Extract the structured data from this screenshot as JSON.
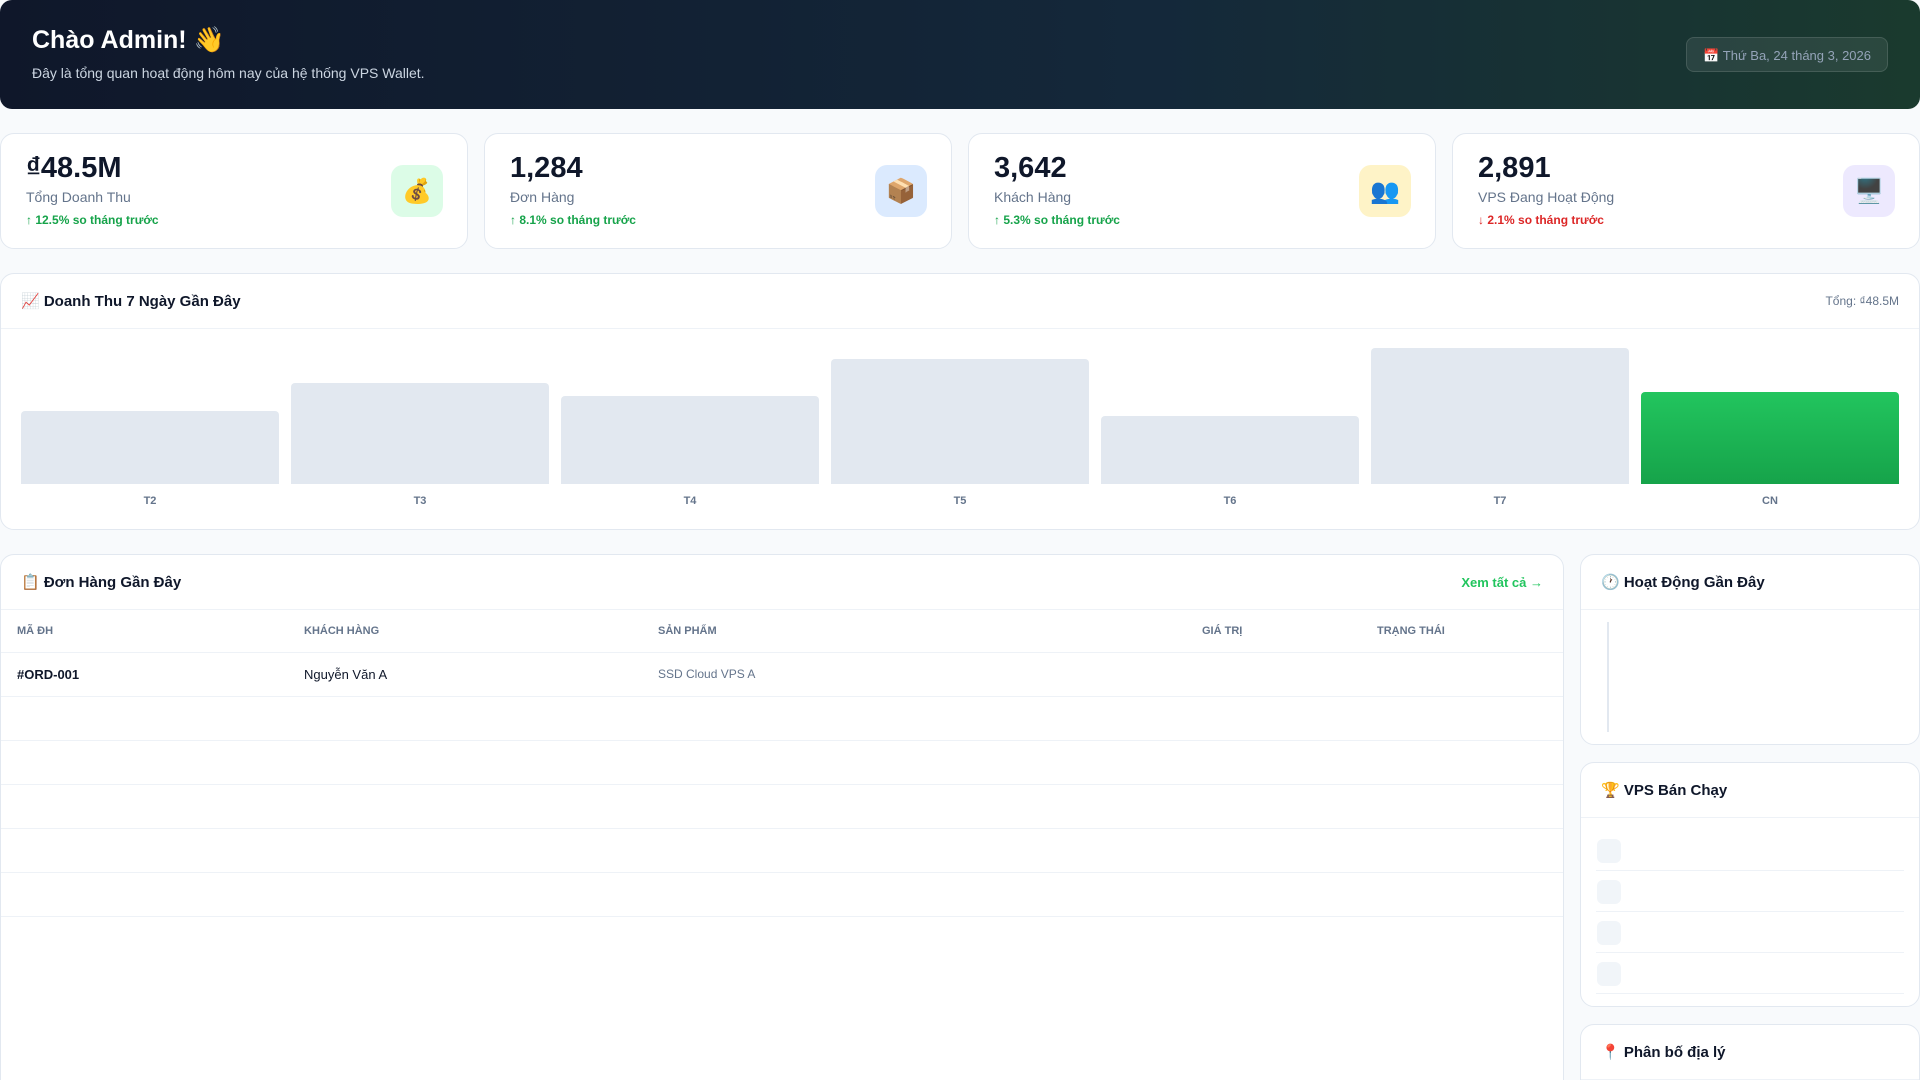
{
  "header": {
    "title": "Chào Admin! 👋",
    "subtitle": "Đây là tổng quan hoạt động hôm nay của hệ thống VPS Wallet.",
    "date": "📅 Thứ Ba, 24 tháng 3, 2026"
  },
  "stats": [
    {
      "value": "₫48.5M",
      "label": "Tổng Doanh Thu",
      "change": "↑ 12.5% so tháng trước",
      "icon": "💰",
      "icon_bg": "#dcfce7"
    },
    {
      "value": "1,284",
      "label": "Đơn Hàng",
      "change": "↑ 8.1% so tháng trước",
      "icon": "📦",
      "icon_bg": "#dbeafe"
    },
    {
      "value": "3,642",
      "label": "Khách Hàng",
      "change": "↑ 5.3% so tháng trước",
      "icon": "👥",
      "icon_bg": "#fef3c7"
    },
    {
      "value": "2,891",
      "label": "VPS Đang Hoạt Động",
      "change": "↓ 2.1% so tháng trước",
      "icon": "🖥️",
      "icon_bg": "#ede9fe"
    }
  ],
  "revenue": {
    "title": "📈 Doanh Thu 7 Ngày Gần Đây",
    "total": "Tổng: ₫48.5M"
  },
  "chart_data": {
    "type": "bar",
    "title": "📈 Doanh Thu 7 Ngày Gần Đây",
    "categories": [
      "T2",
      "T3",
      "T4",
      "T5",
      "T6",
      "T7",
      "CN"
    ],
    "values": [
      0.54,
      0.74,
      0.65,
      0.92,
      0.5,
      1.0,
      0.68
    ],
    "value_scale": "relative bar height (no axis printed)",
    "highlight": "CN",
    "colors": {
      "bar": "#e2e8f0",
      "highlight": "#22c55e"
    }
  },
  "orders": {
    "title": "📋 Đơn Hàng Gần Đây",
    "view_all": "Xem tất cả →",
    "columns": [
      "MÃ ĐH",
      "KHÁCH HÀNG",
      "SẢN PHẨM",
      "GIÁ TRỊ",
      "TRẠNG THÁI"
    ],
    "rows": [
      {
        "id": "#ORD-001",
        "customer": "Nguyễn Văn A",
        "product": "SSD Cloud VPS A",
        "value": "",
        "status": ""
      }
    ]
  },
  "activity": {
    "title": "🕐 Hoạt Động Gần Đây"
  },
  "top_vps": {
    "title": "🏆 VPS Bán Chạy"
  },
  "geo": {
    "title": "📍 Phân bố địa lý"
  }
}
